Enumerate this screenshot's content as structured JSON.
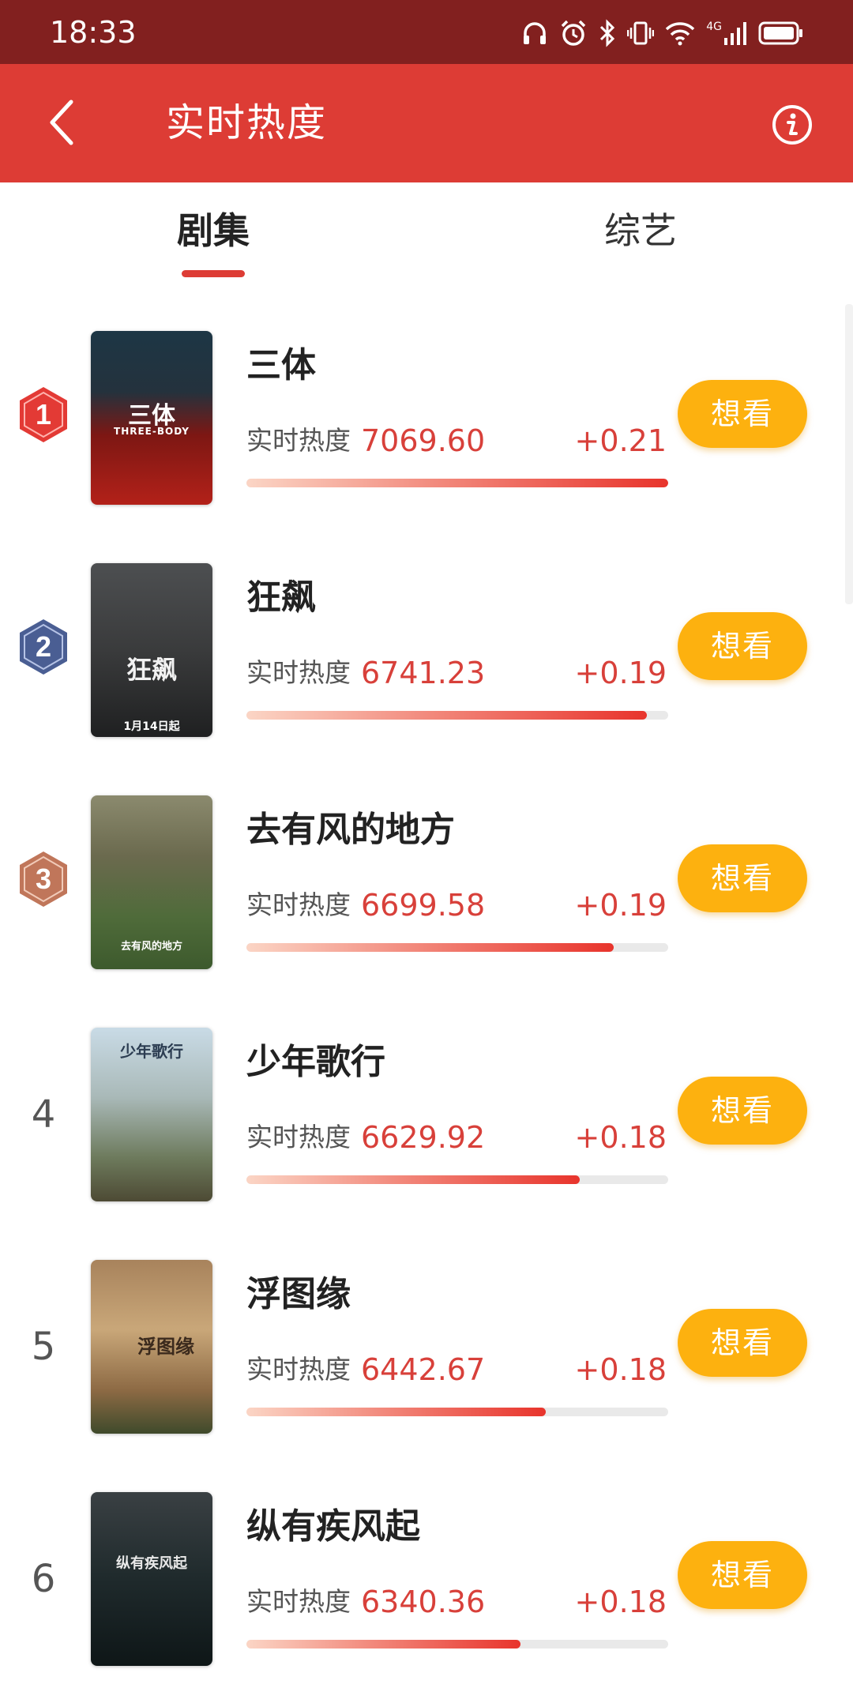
{
  "status_bar": {
    "time": "18:33",
    "network_label": "4G",
    "icons": [
      "headphones-icon",
      "alarm-icon",
      "bluetooth-icon",
      "vibrate-icon",
      "wifi-icon",
      "signal-icon",
      "battery-icon"
    ]
  },
  "header": {
    "title": "实时热度",
    "back_icon": "chevron-left-icon",
    "info_icon": "info-icon",
    "accent": "#dd3c35"
  },
  "tabs": [
    {
      "label": "剧集",
      "active": true
    },
    {
      "label": "综艺",
      "active": false
    }
  ],
  "heat_label": "实时热度",
  "want_label": "想看",
  "list": [
    {
      "rank": "1",
      "title": "三体",
      "heat": "7069.60",
      "delta": "+0.21",
      "fill": 1.0,
      "poster_text": "三体",
      "poster_sub": "THREE-BODY"
    },
    {
      "rank": "2",
      "title": "狂飙",
      "heat": "6741.23",
      "delta": "+0.19",
      "fill": 0.95,
      "poster_text": "狂飙",
      "poster_sub": "1月14日起"
    },
    {
      "rank": "3",
      "title": "去有风的地方",
      "heat": "6699.58",
      "delta": "+0.19",
      "fill": 0.87,
      "poster_text": "去有风的地方",
      "poster_sub": ""
    },
    {
      "rank": "4",
      "title": "少年歌行",
      "heat": "6629.92",
      "delta": "+0.18",
      "fill": 0.79,
      "poster_text": "少年歌行",
      "poster_sub": ""
    },
    {
      "rank": "5",
      "title": "浮图缘",
      "heat": "6442.67",
      "delta": "+0.18",
      "fill": 0.71,
      "poster_text": "浮图缘",
      "poster_sub": ""
    },
    {
      "rank": "6",
      "title": "纵有疾风起",
      "heat": "6340.36",
      "delta": "+0.18",
      "fill": 0.65,
      "poster_text": "纵有疾风起",
      "poster_sub": ""
    }
  ],
  "colors": {
    "status_bar": "#82201f",
    "header": "#dd3c35",
    "heat_text": "#d8403a",
    "want_button": "#fdb10f",
    "rank1_badge": "#e33a35",
    "rank2_badge": "#4a5e93",
    "rank3_badge": "#c0765a"
  }
}
